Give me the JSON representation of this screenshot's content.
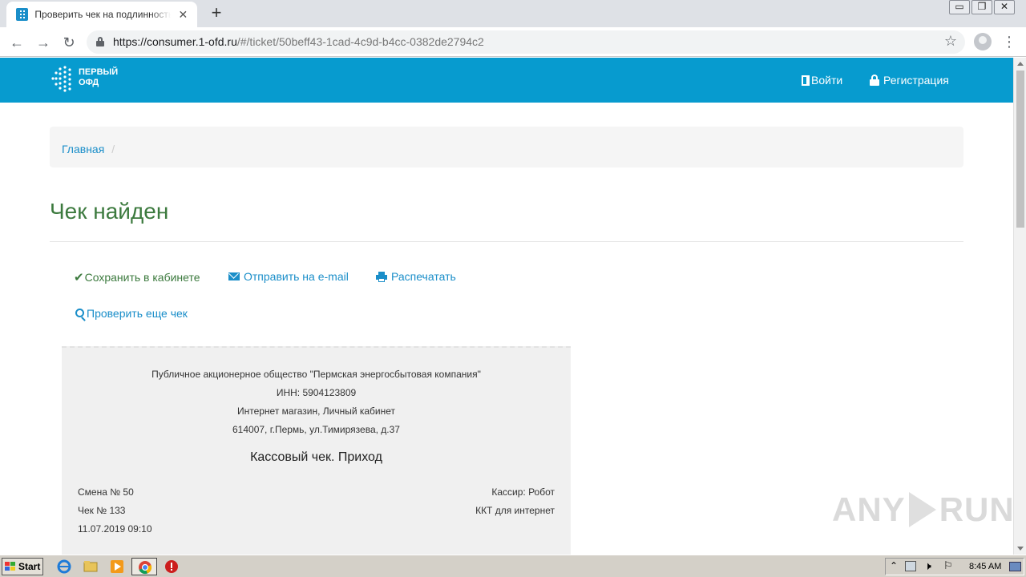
{
  "browser": {
    "tab_title": "Проверить чек на подлинность онлайн",
    "tab_close": "✕",
    "new_tab": "+",
    "url_host": "https://consumer.1-ofd.ru",
    "url_path": "/#/ticket/50beff43-1cad-4c9d-b4cc-0382de2794c2",
    "window_controls": [
      "▭",
      "❐",
      "✕"
    ]
  },
  "site": {
    "logo_line1": "ПЕРВЫЙ",
    "logo_line2": "ОФД",
    "nav_login": "Войти",
    "nav_register": "Регистрация"
  },
  "breadcrumb": {
    "home": "Главная",
    "separator": "/"
  },
  "page": {
    "title": "Чек найден"
  },
  "actions": {
    "save": "Сохранить в кабинете",
    "email": "Отправить на e-mail",
    "print": "Распечатать",
    "check_another": "Проверить еще чек"
  },
  "receipt": {
    "company": "Публичное акционерное общество \"Пермская энергосбытовая компания\"",
    "inn": "ИНН: 5904123809",
    "store": "Интернет магазин, Личный кабинет",
    "address": "614007, г.Пермь, ул.Тимирязева, д.37",
    "title": "Кассовый чек. Приход",
    "shift": "Смена № 50",
    "cashier": "Кассир: Робот",
    "check_no": "Чек № 133",
    "kkt": "ККТ для интернет",
    "datetime": "11.07.2019 09:10"
  },
  "watermark": {
    "left": "ANY",
    "right": "RUN"
  },
  "taskbar": {
    "start": "Start",
    "time": "8:45 AM"
  },
  "colors": {
    "brand": "#079bcf",
    "link": "#1a8ec9",
    "title_green": "#3c7a3e"
  }
}
